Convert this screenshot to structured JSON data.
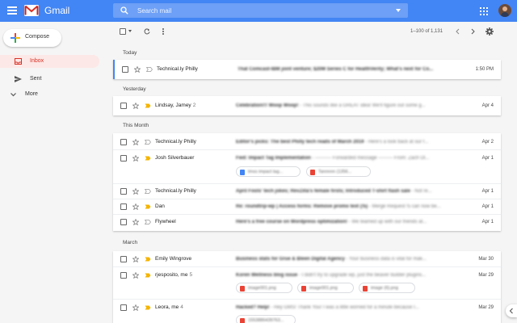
{
  "app": {
    "brand": "Gmail"
  },
  "search": {
    "placeholder": "Search mail"
  },
  "sidebar": {
    "compose_label": "Compose",
    "items": [
      {
        "label": "Inbox",
        "icon": "inbox-icon"
      },
      {
        "label": "Sent",
        "icon": "send-icon"
      },
      {
        "label": "More",
        "icon": "chevron-down-icon"
      }
    ]
  },
  "toolbar": {
    "pager": "1–100 of 1,131"
  },
  "sections": {
    "today": "Today",
    "yesterday": "Yesterday",
    "this_month": "This Month",
    "march": "March"
  },
  "emails": [
    {
      "sender": "Technical.ly Philly",
      "count": "",
      "subject": "That Comcast-IBM joint venture; $20M Series C for HealthVerity; What's next for Co...",
      "snippet": "",
      "date": "1:50 PM",
      "important": false
    },
    {
      "sender": "Lindsay, Jamey",
      "count": "2",
      "subject": "Celebration!!! Woop Woop!",
      "snippet": " - This sounds like a GREAT idea! We'll figure out some g...",
      "date": "Apr 4",
      "important": true
    },
    {
      "sender": "Technical.ly Philly",
      "count": "",
      "subject": "Editor's picks: The best Philly tech reads of March 2019",
      "snippet": " - Here's a look back at our f...",
      "date": "Apr 2",
      "important": false
    },
    {
      "sender": "Josh Silverbauer",
      "count": "",
      "subject": "Fwd: Impact Tag Implementation",
      "snippet": " - ---------- Forwarded message --------- From: Zach Ol...",
      "date": "Apr 1",
      "important": true
    },
    {
      "sender": "Technical.ly Philly",
      "count": "",
      "subject": "April Fools' tech jokes; RevZilla's female firsts; Introduced T-shirt flash sale",
      "snippet": " - Not re...",
      "date": "Apr 1",
      "important": false
    },
    {
      "sender": "Dan",
      "count": "",
      "subject": "Re: roundtrip-wp | Access forms: Remove promo text (!5)",
      "snippet": " - Merge Request !5 can now be...",
      "date": "Apr 1",
      "important": true
    },
    {
      "sender": "Flywheel",
      "count": "",
      "subject": "Here's a free course on Wordpress optimization!",
      "snippet": " - We teamed up with our friends at...",
      "date": "Apr 1",
      "important": false
    },
    {
      "sender": "Emily Wingrove",
      "count": "",
      "subject": "Business stats for Grue & Bleen Digital Agency",
      "snippet": " - Your business data is vital for mak...",
      "date": "Mar 30",
      "important": true
    },
    {
      "sender": "rjesposito, me",
      "count": "5",
      "subject": "Koren Wellness blog issue",
      "snippet": " - I didn't try to upgrade wp, just the beaver builder plugins...",
      "date": "Mar 29",
      "important": true
    },
    {
      "sender": "Leora, me",
      "count": "4",
      "subject": "Hacked? Help!",
      "snippet": " - Hey GMS! Thank You! I was a little worried for a minute because I...",
      "date": "Mar 29",
      "important": true
    }
  ],
  "attachments": {
    "josh": [
      "tmss impact tag...",
      "Tannnnn (1356..."
    ],
    "rjesposito": [
      "image001.png",
      "image001.png",
      "image (6).png"
    ],
    "leora": [
      "1553886439763..."
    ]
  },
  "colors": {
    "header": "#4285f4",
    "active_nav_bg": "#fce8e6",
    "active_nav_text": "#d93025",
    "important": "#f4b400"
  }
}
